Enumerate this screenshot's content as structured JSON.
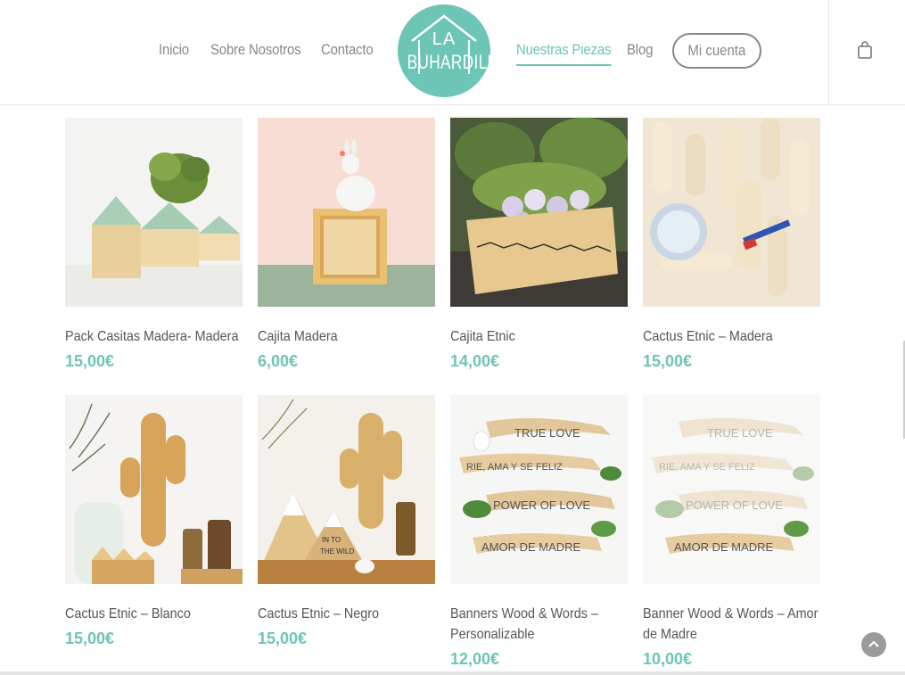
{
  "nav": {
    "left_items": [
      {
        "label": "Inicio"
      },
      {
        "label": "Sobre Nosotros"
      },
      {
        "label": "Contacto"
      }
    ],
    "right_items": [
      {
        "label": "Nuestras Piezas",
        "active": true
      },
      {
        "label": "Blog"
      }
    ],
    "account_label": "Mi cuenta",
    "logo": {
      "line1": "LA",
      "line2": "BUHARDILLA"
    }
  },
  "colors": {
    "accent": "#6cc5b5",
    "nav_text": "#888888",
    "body_text": "#555555"
  },
  "icons": [
    "shopping-bag-icon",
    "chevron-up-icon"
  ],
  "products": [
    {
      "name": "Pack Casitas Madera- Madera",
      "price": "15,00€"
    },
    {
      "name": "Cajita Madera",
      "price": "6,00€"
    },
    {
      "name": "Cajita Etnic",
      "price": "14,00€"
    },
    {
      "name": "Cactus Etnic – Madera",
      "price": "15,00€"
    },
    {
      "name": "Cactus Etnic – Blanco",
      "price": "15,00€"
    },
    {
      "name": "Cactus Etnic – Negro",
      "price": "15,00€"
    },
    {
      "name": "Banners Wood & Words – Personalizable",
      "price": "12,00€"
    },
    {
      "name": "Banner Wood & Words – Amor de Madre",
      "price": "10,00€"
    }
  ]
}
